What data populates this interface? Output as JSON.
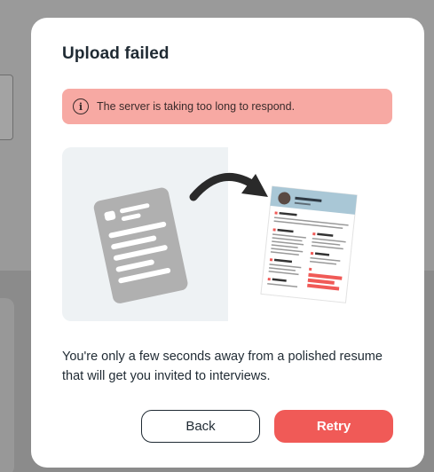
{
  "background": {
    "overlay_color": "#8f8f8f"
  },
  "modal": {
    "title": "Upload failed",
    "alert": {
      "icon": "info-icon",
      "text": "The server is taking too long to respond.",
      "color": "#f7a9a3"
    },
    "illustration": {
      "left_icon": "document-icon",
      "arrow_icon": "curved-arrow-icon",
      "right_image": "resume-preview"
    },
    "description": "You're only a few seconds away from a polished resume that will get you invited to interviews.",
    "buttons": {
      "back_label": "Back",
      "retry_label": "Retry",
      "retry_color": "#f05a57"
    }
  }
}
